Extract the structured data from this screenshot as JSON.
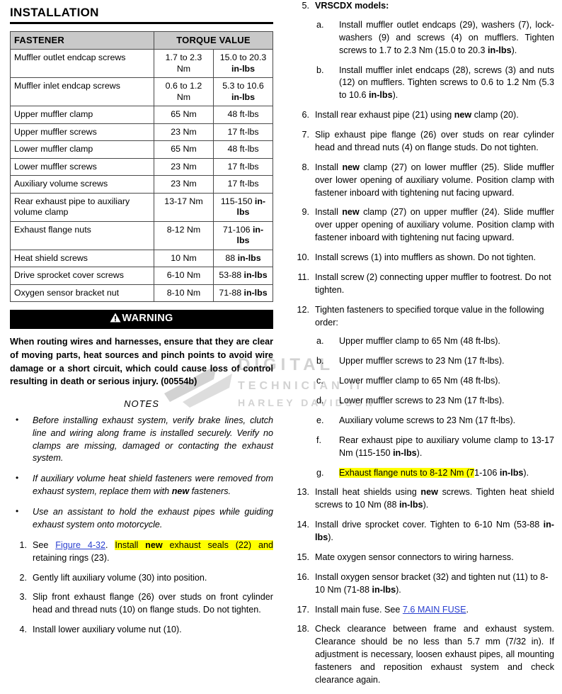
{
  "watermark": {
    "line1": "DIGITAL",
    "line2": "TECHNICIAN II",
    "line3": "HARLEY DAVIDSON"
  },
  "left": {
    "section_title": "INSTALLATION",
    "table": {
      "headers": [
        "FASTENER",
        "TORQUE VALUE"
      ],
      "rows": [
        {
          "fastener": "Muffler outlet endcap screws",
          "nm": "1.7 to 2.3 Nm",
          "imperial": "15.0 to 20.3 ",
          "imperial_bold": "in-lbs"
        },
        {
          "fastener": "Muffler inlet endcap screws",
          "nm": "0.6 to 1.2 Nm",
          "imperial": "5.3 to 10.6 ",
          "imperial_bold": "in-lbs"
        },
        {
          "fastener": "Upper muffler clamp",
          "nm": "65 Nm",
          "imperial": "48 ft-lbs",
          "imperial_bold": ""
        },
        {
          "fastener": "Upper muffler screws",
          "nm": "23 Nm",
          "imperial": "17 ft-lbs",
          "imperial_bold": ""
        },
        {
          "fastener": "Lower muffler clamp",
          "nm": "65 Nm",
          "imperial": "48 ft-lbs",
          "imperial_bold": ""
        },
        {
          "fastener": "Lower muffler screws",
          "nm": "23 Nm",
          "imperial": "17 ft-lbs",
          "imperial_bold": ""
        },
        {
          "fastener": "Auxiliary volume screws",
          "nm": "23 Nm",
          "imperial": "17 ft-lbs",
          "imperial_bold": ""
        },
        {
          "fastener": "Rear exhaust pipe to auxiliary volume clamp",
          "nm": "13-17 Nm",
          "imperial": "115-150 ",
          "imperial_bold": "in-lbs"
        },
        {
          "fastener": "Exhaust flange nuts",
          "nm": "8-12 Nm",
          "imperial": "71-106 ",
          "imperial_bold": "in-lbs"
        },
        {
          "fastener": "Heat shield screws",
          "nm": "10 Nm",
          "imperial": "88 ",
          "imperial_bold": "in-lbs"
        },
        {
          "fastener": "Drive sprocket cover screws",
          "nm": "6-10 Nm",
          "imperial": "53-88 ",
          "imperial_bold": "in-lbs"
        },
        {
          "fastener": "Oxygen sensor bracket nut",
          "nm": "8-10 Nm",
          "imperial": "71-88 ",
          "imperial_bold": "in-lbs"
        }
      ]
    },
    "warning": {
      "icon": "warning-triangle-icon",
      "label": "WARNING",
      "body": "When routing wires and harnesses, ensure that they are clear of moving parts, heat sources and pinch points to avoid wire damage or a short circuit, which could cause loss of control resulting in death or serious injury. (00554b)"
    },
    "notes_heading": "NOTES",
    "notes": [
      "Before installing exhaust system, verify brake lines, clutch line and wiring along frame is installed securely. Verify no clamps are missing, damaged or contacting the exhaust system.",
      "If auxiliary volume heat shield fasteners were removed from exhaust system, replace them with new fasteners.",
      "Use an assistant to hold the exhaust pipes while guiding exhaust system onto motorcycle."
    ],
    "note2_bold_word": "new",
    "steps": {
      "s1": {
        "num": "1.",
        "pre": "See ",
        "link": "Figure 4-32",
        "post_dot": ". ",
        "hl_a": "Install ",
        "hl_bold": "new",
        "hl_b": " exhaust seals (22) and",
        "tail": " retaining rings (23)."
      },
      "s2": {
        "num": "2.",
        "text": "Gently lift auxiliary volume (30) into position."
      },
      "s3": {
        "num": "3.",
        "text": "Slip front exhaust flange (26) over studs on front cylinder head and thread nuts (10) on flange studs. Do not tighten."
      },
      "s4": {
        "num": "4.",
        "text": "Install lower auxiliary volume nut (10)."
      }
    }
  },
  "right": {
    "s5": {
      "num": "5.",
      "heading": "VRSCDX models:",
      "a": {
        "num": "a.",
        "t1": "Install muffler outlet endcaps (29), washers (7), lock-washers (9) and screws (4) on mufflers. Tighten screws to 1.7 to 2.3 Nm (15.0 to 20.3 ",
        "b1": "in-lbs",
        "t2": ")."
      },
      "b": {
        "num": "b.",
        "t1": "Install muffler inlet endcaps (28), screws (3) and nuts (12) on mufflers. Tighten screws to 0.6 to 1.2 Nm (5.3 to 10.6 ",
        "b1": "in-lbs",
        "t2": ")."
      }
    },
    "s6": {
      "num": "6.",
      "t1": "Install rear exhaust pipe (21) using ",
      "b1": "new",
      "t2": " clamp (20)."
    },
    "s7": {
      "num": "7.",
      "text": "Slip exhaust pipe flange (26) over studs on rear cylinder head and thread nuts (4) on flange studs. Do not tighten."
    },
    "s8": {
      "num": "8.",
      "t1": "Install ",
      "b1": "new",
      "t2": " clamp (27) on lower muffler (25). Slide muffler over lower opening of auxiliary volume. Position clamp with fastener inboard with tightening nut facing upward."
    },
    "s9": {
      "num": "9.",
      "t1": "Install ",
      "b1": "new",
      "t2": " clamp (27) on upper muffler (24). Slide muffler over upper opening of auxiliary volume. Position clamp with fastener inboard with tightening nut facing upward."
    },
    "s10": {
      "num": "10.",
      "text": "Install screws (1) into mufflers as shown. Do not tighten."
    },
    "s11": {
      "num": "11.",
      "text": "Install screw (2) connecting upper muffler to footrest. Do not tighten."
    },
    "s12": {
      "num": "12.",
      "heading": "Tighten fasteners to specified torque value in the following order:",
      "items": [
        {
          "num": "a.",
          "text": "Upper muffler clamp to 65 Nm (48 ft-lbs)."
        },
        {
          "num": "b.",
          "text": "Upper muffler screws to 23 Nm (17 ft-lbs)."
        },
        {
          "num": "c.",
          "text": "Lower muffler clamp to 65 Nm (48 ft-lbs)."
        },
        {
          "num": "d.",
          "text": "Lower muffler screws to 23 Nm (17 ft-lbs)."
        },
        {
          "num": "e.",
          "text": "Auxiliary volume screws to 23 Nm (17 ft-lbs)."
        }
      ],
      "f": {
        "num": "f.",
        "t1": "Rear exhaust pipe to auxiliary volume clamp to 13-17 Nm (115-150 ",
        "b1": "in-lbs",
        "t2": ")."
      },
      "g": {
        "num": "g.",
        "hl": "Exhaust flange nuts to 8-12 Nm (7",
        "t1": "1-106 ",
        "b1": "in-lbs",
        "t2": ")."
      }
    },
    "s13": {
      "num": "13.",
      "t1": "Install heat shields using ",
      "b1": "new",
      "t2": " screws. Tighten heat shield screws to 10 Nm (88 ",
      "b2": "in-lbs",
      "t3": ")."
    },
    "s14": {
      "num": "14.",
      "t1": "Install drive sprocket cover. Tighten to 6-10 Nm (53-88 ",
      "b1": "in-lbs",
      "t2": ")."
    },
    "s15": {
      "num": "15.",
      "text": "Mate oxygen sensor connectors to wiring harness."
    },
    "s16": {
      "num": "16.",
      "t1": "Install oxygen sensor bracket (32) and tighten nut (11) to 8-10 Nm (71-88 ",
      "b1": "in-lbs",
      "t2": ")."
    },
    "s17": {
      "num": "17.",
      "t1": "Install main fuse. See ",
      "link": "7.6 MAIN FUSE",
      "t2": "."
    },
    "s18": {
      "num": "18.",
      "text": "Check clearance between frame and exhaust system. Clearance should be no less than 5.7 mm (7/32 in). If adjustment is necessary, loosen exhaust pipes, all mounting fasteners and reposition exhaust system and check clearance again."
    }
  }
}
